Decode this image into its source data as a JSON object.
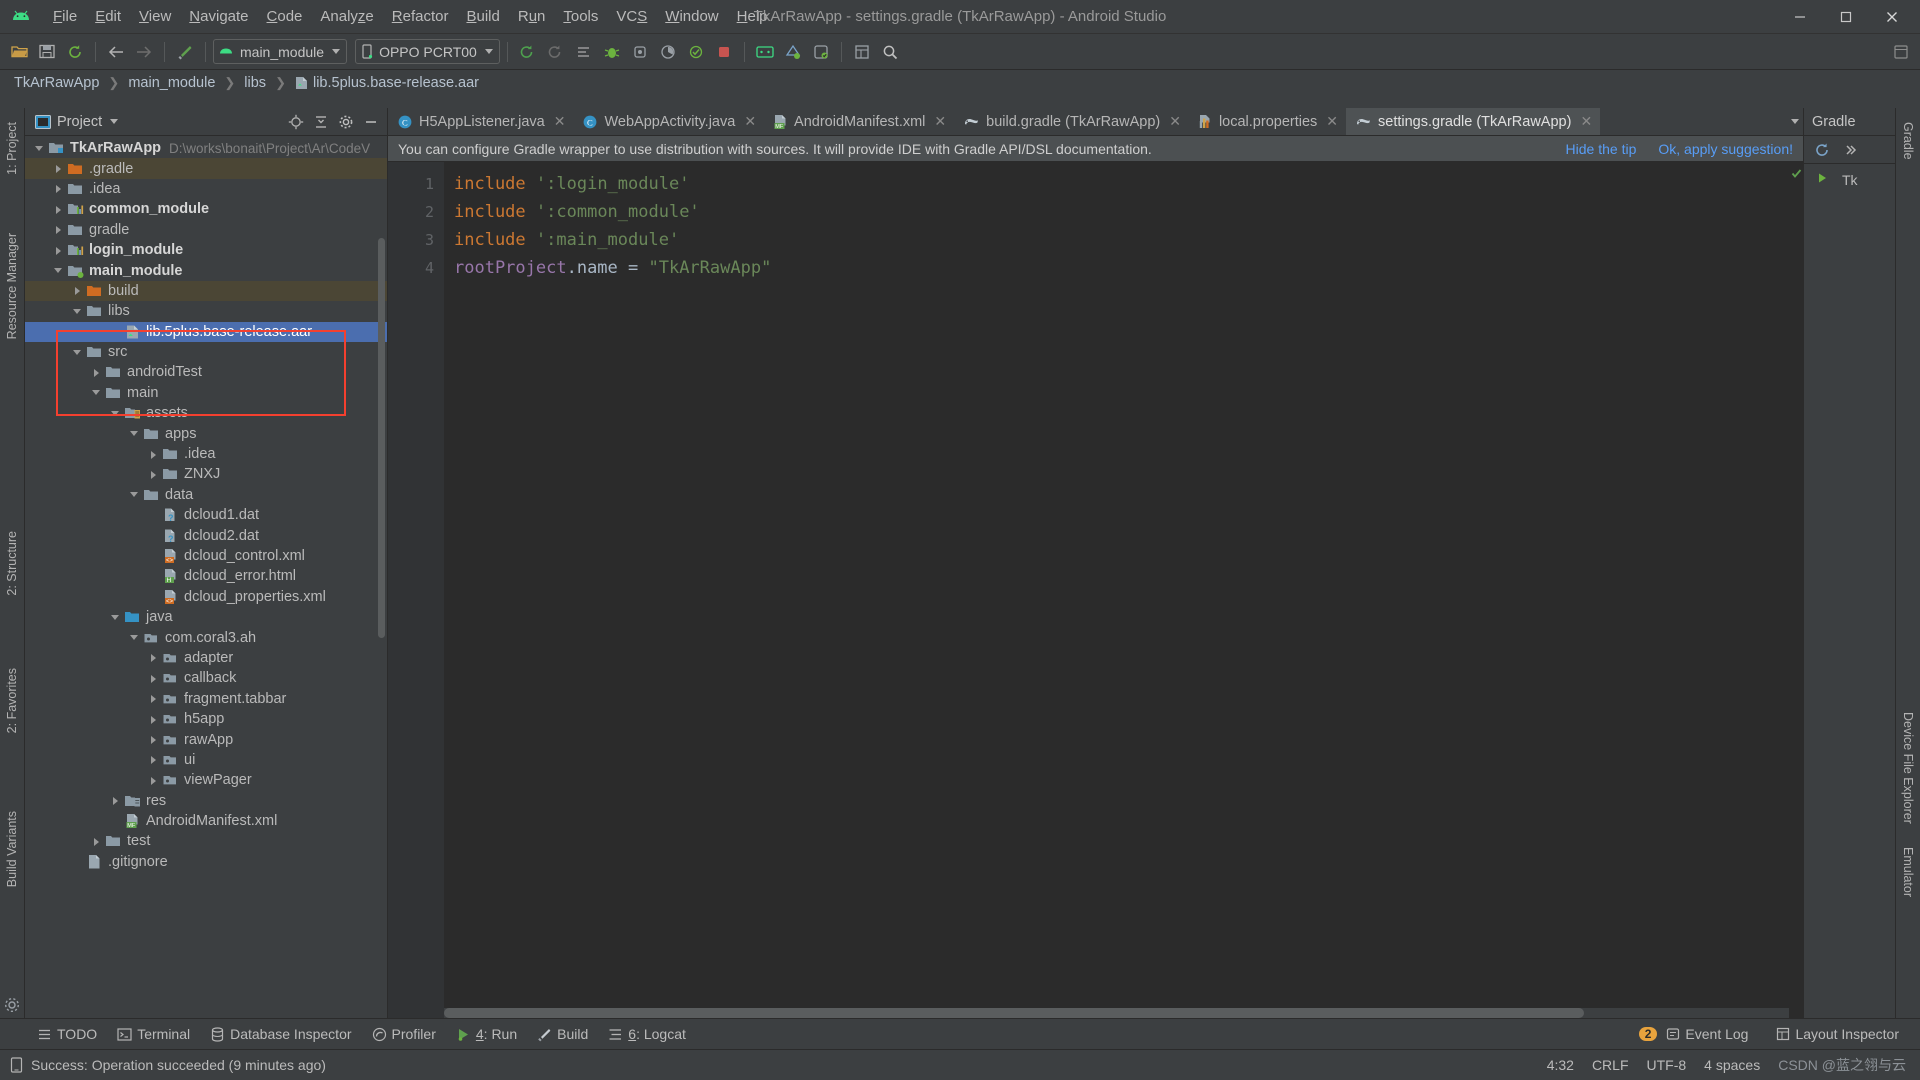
{
  "window": {
    "title": "TkArRawApp - settings.gradle (TkArRawApp) - Android Studio",
    "minimize": "—",
    "maximize": "❐",
    "close": "✕"
  },
  "menubar": {
    "items": [
      {
        "label": "File"
      },
      {
        "label": "Edit"
      },
      {
        "label": "View"
      },
      {
        "label": "Navigate"
      },
      {
        "label": "Code"
      },
      {
        "label": "Analyze"
      },
      {
        "label": "Refactor"
      },
      {
        "label": "Build"
      },
      {
        "label": "Run"
      },
      {
        "label": "Tools"
      },
      {
        "label": "VCS"
      },
      {
        "label": "Window"
      },
      {
        "label": "Help"
      }
    ]
  },
  "toolbar": {
    "module_selector": "main_module",
    "device_selector": "OPPO PCRT00",
    "icons": [
      "open-folder-icon",
      "save-icon",
      "sync-icon",
      "back-arrow-icon",
      "forward-arrow-icon",
      "build-hammer-icon",
      "run-icon",
      "debug-icon",
      "profile-icon",
      "apply-changes-icon",
      "stop-icon",
      "avd-manager-icon",
      "sdk-manager-icon",
      "device-file-explorer-icon",
      "layout-inspector-icon",
      "search-icon"
    ]
  },
  "breadcrumb": {
    "items": [
      {
        "label": "TkArRawApp",
        "icon": "project-icon"
      },
      {
        "label": "main_module",
        "icon": "module-icon"
      },
      {
        "label": "libs",
        "icon": "folder-icon"
      },
      {
        "label": "lib.5plus.base-release.aar",
        "icon": "aar-file-icon"
      }
    ],
    "separator": "❯"
  },
  "left_strip": {
    "items": [
      "1: Project",
      "Resource Manager",
      "2: Structure",
      "2: Favorites",
      "Build Variants"
    ]
  },
  "right_strip": {
    "items": [
      "Gradle",
      "Device File Explorer",
      "Emulator"
    ]
  },
  "project_panel": {
    "title": "Project",
    "icons": [
      "locate-icon",
      "collapse-all-icon",
      "settings-gear-icon",
      "hide-icon"
    ],
    "tree": [
      {
        "depth": 0,
        "arrow": "open",
        "icon": "project-root-icon",
        "label": "TkArRawApp",
        "bold": true,
        "path": "D:\\works\\bonait\\Project\\Ar\\CodeV",
        "state": "normal"
      },
      {
        "depth": 1,
        "arrow": "closed",
        "icon": "folder-orange-icon",
        "label": ".gradle",
        "state": "highlight"
      },
      {
        "depth": 1,
        "arrow": "closed",
        "icon": "folder-icon",
        "label": ".idea",
        "state": "normal"
      },
      {
        "depth": 1,
        "arrow": "closed",
        "icon": "module-icon",
        "label": "common_module",
        "bold": true,
        "state": "normal"
      },
      {
        "depth": 1,
        "arrow": "closed",
        "icon": "folder-icon",
        "label": "gradle",
        "state": "normal"
      },
      {
        "depth": 1,
        "arrow": "closed",
        "icon": "module-icon",
        "label": "login_module",
        "bold": true,
        "state": "normal"
      },
      {
        "depth": 1,
        "arrow": "open",
        "icon": "module-active-icon",
        "label": "main_module",
        "bold": true,
        "state": "normal"
      },
      {
        "depth": 2,
        "arrow": "closed",
        "icon": "folder-orange-icon",
        "label": "build",
        "state": "highlight"
      },
      {
        "depth": 2,
        "arrow": "open",
        "icon": "folder-icon",
        "label": "libs",
        "state": "normal"
      },
      {
        "depth": 4,
        "arrow": "none",
        "icon": "aar-file-icon",
        "label": "lib.5plus.base-release.aar",
        "state": "selected"
      },
      {
        "depth": 2,
        "arrow": "open",
        "icon": "folder-icon",
        "label": "src",
        "state": "normal"
      },
      {
        "depth": 3,
        "arrow": "closed",
        "icon": "folder-icon",
        "label": "androidTest",
        "state": "normal"
      },
      {
        "depth": 3,
        "arrow": "open",
        "icon": "folder-icon",
        "label": "main",
        "state": "normal"
      },
      {
        "depth": 4,
        "arrow": "open",
        "icon": "assets-folder-icon",
        "label": "assets",
        "state": "normal"
      },
      {
        "depth": 5,
        "arrow": "open",
        "icon": "folder-icon",
        "label": "apps",
        "state": "normal"
      },
      {
        "depth": 6,
        "arrow": "closed",
        "icon": "folder-icon",
        "label": ".idea",
        "state": "normal"
      },
      {
        "depth": 6,
        "arrow": "closed",
        "icon": "folder-icon",
        "label": "ZNXJ",
        "state": "normal"
      },
      {
        "depth": 5,
        "arrow": "open",
        "icon": "folder-icon",
        "label": "data",
        "state": "normal"
      },
      {
        "depth": 6,
        "arrow": "none",
        "icon": "dat-file-icon",
        "label": "dcloud1.dat",
        "state": "normal"
      },
      {
        "depth": 6,
        "arrow": "none",
        "icon": "dat-file-icon",
        "label": "dcloud2.dat",
        "state": "normal"
      },
      {
        "depth": 6,
        "arrow": "none",
        "icon": "xml-file-icon",
        "label": "dcloud_control.xml",
        "state": "normal"
      },
      {
        "depth": 6,
        "arrow": "none",
        "icon": "html-file-icon",
        "label": "dcloud_error.html",
        "state": "normal"
      },
      {
        "depth": 6,
        "arrow": "none",
        "icon": "xml-file-icon",
        "label": "dcloud_properties.xml",
        "state": "normal"
      },
      {
        "depth": 4,
        "arrow": "open",
        "icon": "java-source-folder-icon",
        "label": "java",
        "state": "normal"
      },
      {
        "depth": 5,
        "arrow": "open",
        "icon": "package-icon",
        "label": "com.coral3.ah",
        "state": "normal"
      },
      {
        "depth": 6,
        "arrow": "closed",
        "icon": "package-icon",
        "label": "adapter",
        "state": "normal"
      },
      {
        "depth": 6,
        "arrow": "closed",
        "icon": "package-icon",
        "label": "callback",
        "state": "normal"
      },
      {
        "depth": 6,
        "arrow": "closed",
        "icon": "package-icon",
        "label": "fragment.tabbar",
        "state": "normal"
      },
      {
        "depth": 6,
        "arrow": "closed",
        "icon": "package-icon",
        "label": "h5app",
        "state": "normal"
      },
      {
        "depth": 6,
        "arrow": "closed",
        "icon": "package-icon",
        "label": "rawApp",
        "state": "normal"
      },
      {
        "depth": 6,
        "arrow": "closed",
        "icon": "package-icon",
        "label": "ui",
        "state": "normal"
      },
      {
        "depth": 6,
        "arrow": "closed",
        "icon": "package-icon",
        "label": "viewPager",
        "state": "normal"
      },
      {
        "depth": 4,
        "arrow": "closed",
        "icon": "res-folder-icon",
        "label": "res",
        "state": "normal"
      },
      {
        "depth": 4,
        "arrow": "none",
        "icon": "manifest-file-icon",
        "label": "AndroidManifest.xml",
        "state": "normal"
      },
      {
        "depth": 3,
        "arrow": "closed",
        "icon": "folder-icon",
        "label": "test",
        "state": "normal"
      },
      {
        "depth": 2,
        "arrow": "none",
        "icon": "gitignore-file-icon",
        "label": ".gitignore",
        "state": "normal"
      }
    ]
  },
  "editor": {
    "tabs": [
      {
        "label": "H5AppListener.java",
        "icon": "java-class-icon",
        "active": false,
        "close": "✕"
      },
      {
        "label": "WebAppActivity.java",
        "icon": "java-class-icon",
        "active": false,
        "close": "✕"
      },
      {
        "label": "AndroidManifest.xml",
        "icon": "manifest-file-icon",
        "active": false,
        "close": "✕"
      },
      {
        "label": "build.gradle (TkArRawApp)",
        "icon": "gradle-file-icon",
        "active": false,
        "close": "✕"
      },
      {
        "label": "local.properties",
        "icon": "properties-file-icon",
        "active": false,
        "close": "✕"
      },
      {
        "label": "settings.gradle (TkArRawApp)",
        "icon": "gradle-file-icon",
        "active": true,
        "close": "✕"
      }
    ],
    "tab_overflow_icon": "chevron-down-icon",
    "tip": {
      "text": "You can configure Gradle wrapper to use distribution with sources. It will provide IDE with Gradle API/DSL documentation.",
      "hide_label": "Hide the tip",
      "apply_label": "Ok, apply suggestion!"
    },
    "line_numbers": [
      "1",
      "2",
      "3",
      "4"
    ],
    "lines": [
      {
        "tokens": [
          {
            "t": "include",
            "c": "kw"
          },
          {
            "t": " ",
            "c": "punc"
          },
          {
            "t": "':login_module'",
            "c": "str"
          }
        ]
      },
      {
        "tokens": [
          {
            "t": "include",
            "c": "kw"
          },
          {
            "t": " ",
            "c": "punc"
          },
          {
            "t": "':common_module'",
            "c": "str"
          }
        ]
      },
      {
        "tokens": [
          {
            "t": "include",
            "c": "kw"
          },
          {
            "t": " ",
            "c": "punc"
          },
          {
            "t": "':main_module'",
            "c": "str"
          }
        ]
      },
      {
        "tokens": [
          {
            "t": "rootProject",
            "c": "prop"
          },
          {
            "t": ".name = ",
            "c": "punc"
          },
          {
            "t": "\"TkArRawApp\"",
            "c": "str"
          }
        ]
      }
    ],
    "status_ok_icon": "checkmark-icon"
  },
  "gradle_panel": {
    "title": "Gradle",
    "tree_item": "Tk"
  },
  "tool_window_bar": {
    "items": [
      {
        "label": "TODO",
        "icon": "todo-icon",
        "mnemonic": ""
      },
      {
        "label": "Terminal",
        "icon": "terminal-icon",
        "mnemonic": ""
      },
      {
        "label": "Database Inspector",
        "icon": "database-icon",
        "mnemonic": ""
      },
      {
        "label": "Profiler",
        "icon": "profiler-icon",
        "mnemonic": ""
      },
      {
        "label": "4: Run",
        "icon": "run-icon",
        "mnemonic": "4"
      },
      {
        "label": "Build",
        "icon": "build-hammer-icon",
        "mnemonic": ""
      },
      {
        "label": "6: Logcat",
        "icon": "logcat-icon",
        "mnemonic": "6"
      }
    ],
    "right": [
      {
        "label": "Event Log",
        "icon": "event-log-icon",
        "badge": "2"
      },
      {
        "label": "Layout Inspector",
        "icon": "layout-inspector-icon",
        "badge": ""
      }
    ]
  },
  "statusbar": {
    "message": "Success: Operation succeeded (9 minutes ago)",
    "icon": "device-icon",
    "caret_position": "4:32",
    "line_separator": "CRLF",
    "encoding": "UTF-8",
    "indent": "4 spaces",
    "watermark": "CSDN @蓝之翎与云"
  },
  "colors": {
    "accent_blue": "#4b6eaf",
    "link_blue": "#589df6",
    "highlight_red": "#f4402f",
    "string_green": "#6a8759",
    "keyword_orange": "#cc7832",
    "property_purple": "#9876aa",
    "panel_bg": "#3c3f41",
    "editor_bg": "#2b2b2b",
    "badge_orange": "#e8a33d"
  }
}
